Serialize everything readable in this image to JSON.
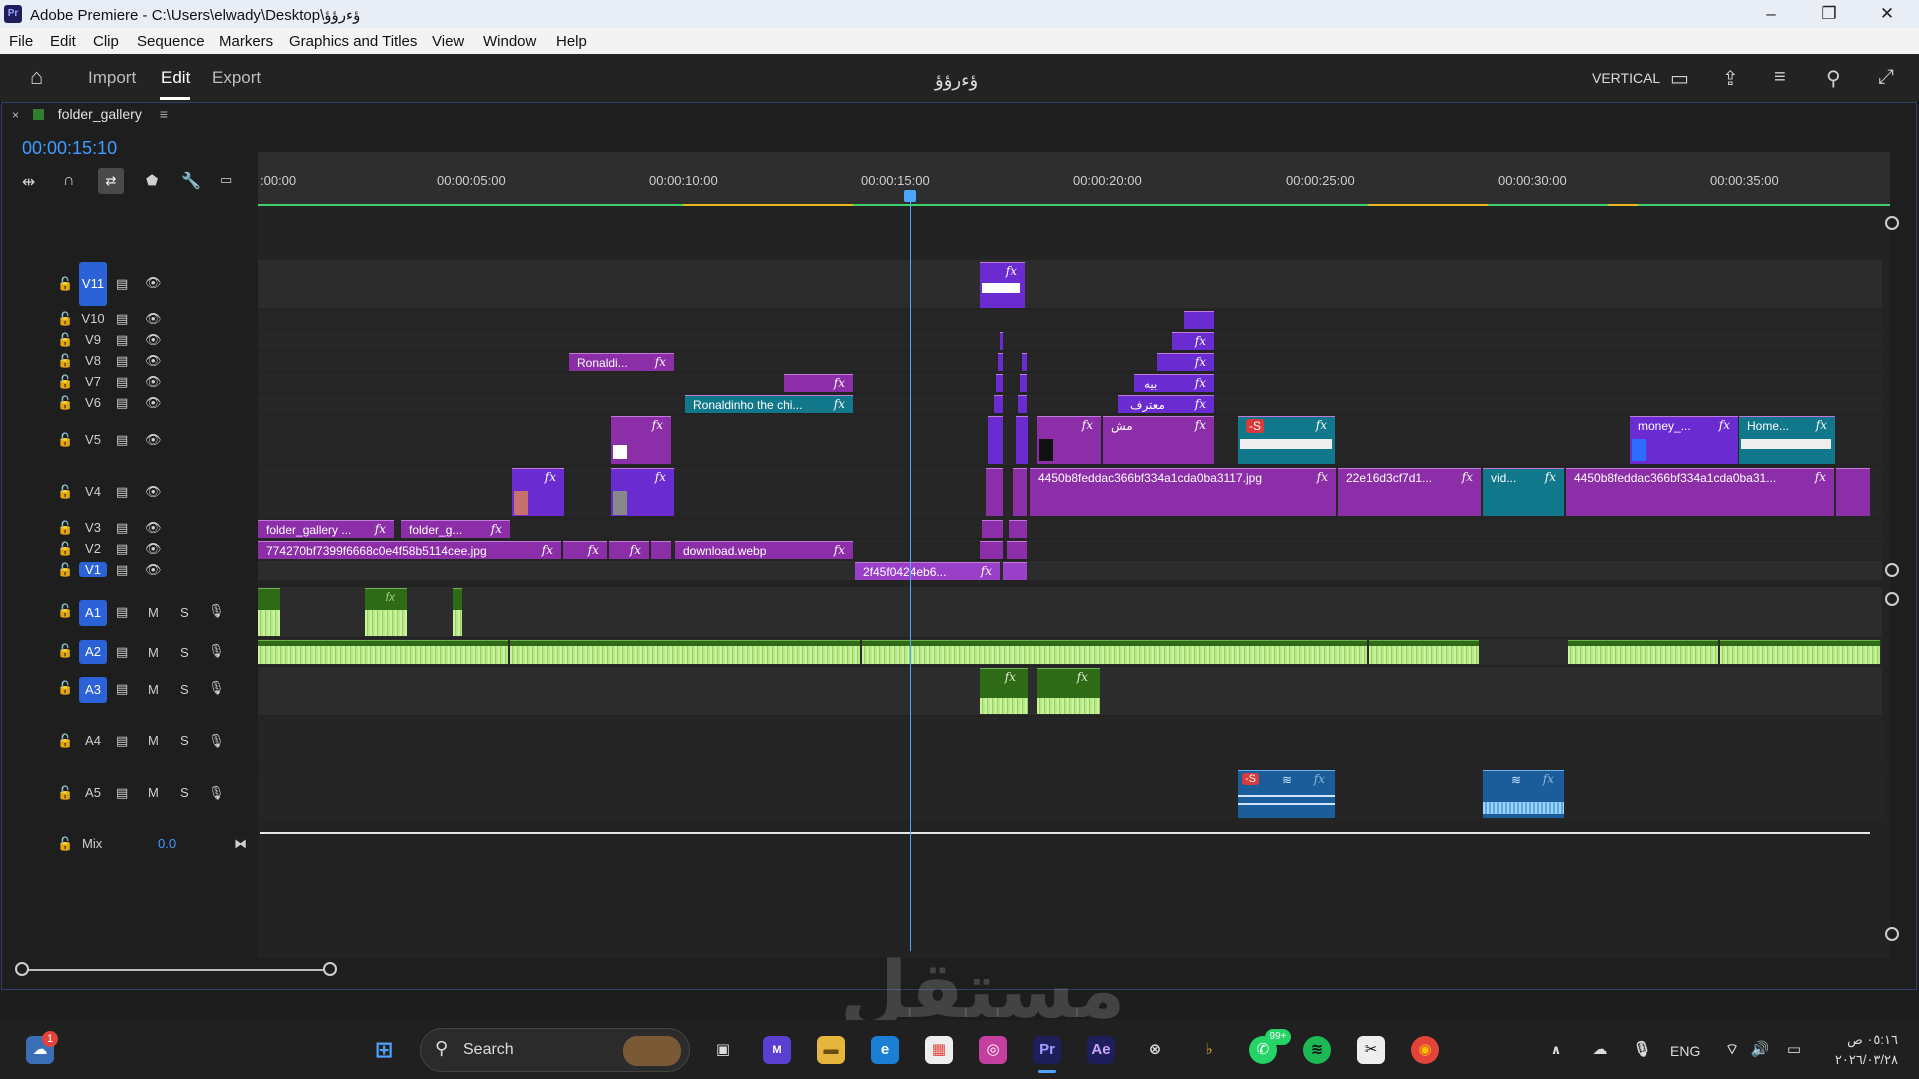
{
  "window": {
    "app_icon": "Pr",
    "title": "Adobe Premiere - C:\\Users\\elwady\\Desktop\\ؤءرؤؤ",
    "controls": [
      "–",
      "❐",
      "✕"
    ]
  },
  "menu": [
    "File",
    "Edit",
    "Clip",
    "Sequence",
    "Markers",
    "Graphics and Titles",
    "View",
    "Window",
    "Help"
  ],
  "header": {
    "tabs": [
      "Import",
      "Edit",
      "Export"
    ],
    "active_tab": "Edit",
    "project_name": "ؤءرؤؤ",
    "layout_label": "VERTICAL"
  },
  "sequence": {
    "tab_name": "folder_gallery",
    "timecode": "00:00:15:10"
  },
  "ruler": {
    "ticks": [
      ":00:00",
      "00:00:05:00",
      "00:00:10:00",
      "00:00:15:00",
      "00:00:20:00",
      "00:00:25:00",
      "00:00:30:00",
      "00:00:35:00"
    ]
  },
  "video_tracks": [
    "V11",
    "V10",
    "V9",
    "V8",
    "V7",
    "V6",
    "V5",
    "V4",
    "V3",
    "V2",
    "V1"
  ],
  "audio_tracks": [
    "A1",
    "A2",
    "A3",
    "A4",
    "A5"
  ],
  "audio_buttons": {
    "mute": "M",
    "solo": "S"
  },
  "mix": {
    "label": "Mix",
    "value": "0.0"
  },
  "clips": {
    "v8": "Ronaldi...",
    "v6": "Ronaldinho the chi...",
    "v6b": "معترف",
    "v7b": "بيه",
    "v5b": "مش",
    "v4a": "4450b8feddac366bf334a1cda0ba3117.jpg",
    "v4b": "22e16d3cf7d1...",
    "v4c": "vid...",
    "v4d": "4450b8feddac366bf334a1cda0ba31...",
    "v5c": "money_...",
    "v5d": "Home...",
    "v3a": "folder_gallery ...",
    "v3b": "folder_g...",
    "v2a": "774270bf7399f6668c0e4f58b5114cee.jpg",
    "v2b": "download.webp",
    "v1a": "2f45f0424eb6...",
    "fx": "fx"
  },
  "taskbar": {
    "search_placeholder": "Search",
    "lang": "ENG",
    "time": "٠٥:١٦ ص",
    "date": "٢٠٢٦/٠٣/٢٨",
    "notif_badge": "1",
    "whatsapp_badge": "99+"
  },
  "watermark": "مستقل"
}
